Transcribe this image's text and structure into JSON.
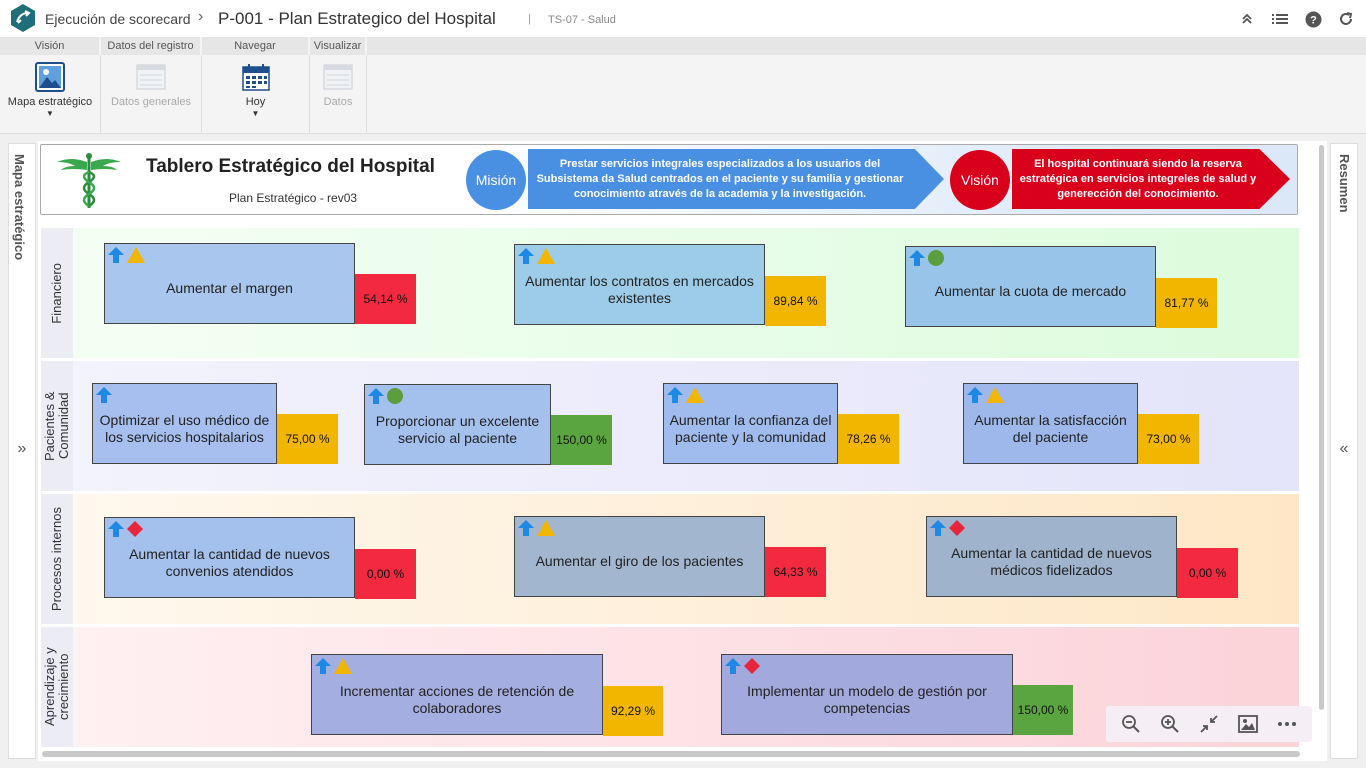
{
  "header": {
    "app_section": "Ejecución de scorecard",
    "page_title": "P-001 - Plan Estrategico del Hospital",
    "context": "TS-07 - Salud"
  },
  "ribbon": {
    "tabs": [
      "Visión",
      "Datos del registro",
      "Navegar",
      "Visualizar"
    ],
    "buttons": {
      "mapa": "Mapa estratégico",
      "datos_generales": "Datos generales",
      "hoy": "Hoy",
      "datos": "Datos"
    }
  },
  "panels": {
    "left_title": "Mapa estratégico",
    "right_title": "Resumen",
    "expand": "»",
    "collapse": "«"
  },
  "scorecard": {
    "title": "Tablero Estratégico del Hospital",
    "subtitle": "Plan Estratégico - rev03",
    "mision_label": "Misión",
    "mision_text": "Prestar servicios integrales especializados a los usuarios del Subsistema da Salud centrados en el paciente y su familia y gestionar conocimiento através de la academia y la investigación.",
    "vision_label": "Visión",
    "vision_text": "El hospital continuará siendo la reserva estratégica en servicios integreles de salud y generección del conocimiento."
  },
  "colors": {
    "blue": "#1e88e5",
    "yellow": "#f2b600",
    "green": "#5a9e3e",
    "red": "#e8253b",
    "pct_red": "#f2293f",
    "pct_yellow": "#f2b600",
    "pct_green": "#5aa53f"
  },
  "perspectives": [
    {
      "name": "Financiero",
      "objectives": [
        {
          "text": "Aumentar el margen",
          "pct": "54,14 %",
          "status": "red",
          "indicator": "triangle"
        },
        {
          "text": "Aumentar los contratos en mercados existentes",
          "pct": "89,84 %",
          "status": "yellow",
          "indicator": "triangle"
        },
        {
          "text": "Aumentar la cuota de mercado",
          "pct": "81,77 %",
          "status": "yellow",
          "indicator": "circle"
        }
      ]
    },
    {
      "name": "Pacientes & Comunidad",
      "objectives": [
        {
          "text": "Optimizar el uso médico de los servicios hospitalarios",
          "pct": "75,00 %",
          "status": "yellow",
          "indicator": "none"
        },
        {
          "text": "Proporcionar un excelente servicio al paciente",
          "pct": "150,00 %",
          "status": "green",
          "indicator": "circle"
        },
        {
          "text": "Aumentar la confianza del paciente y la comunidad",
          "pct": "78,26 %",
          "status": "yellow",
          "indicator": "triangle"
        },
        {
          "text": "Aumentar la satisfacción del paciente",
          "pct": "73,00 %",
          "status": "yellow",
          "indicator": "triangle"
        }
      ]
    },
    {
      "name": "Procesos internos",
      "objectives": [
        {
          "text": "Aumentar la cantidad de nuevos convenios atendidos",
          "pct": "0,00 %",
          "status": "red",
          "indicator": "diamond"
        },
        {
          "text": "Aumentar el giro de los pacientes",
          "pct": "64,33 %",
          "status": "red",
          "indicator": "triangle"
        },
        {
          "text": "Aumentar la cantidad de nuevos médicos fidelizados",
          "pct": "0,00 %",
          "status": "red",
          "indicator": "diamond"
        }
      ]
    },
    {
      "name": "Aprendizaje y crecimiento",
      "objectives": [
        {
          "text": "Incrementar acciones de retención de colaboradores",
          "pct": "92,29 %",
          "status": "yellow",
          "indicator": "triangle"
        },
        {
          "text": "Implementar un modelo de gestión por competencias",
          "pct": "150,00 %",
          "status": "green",
          "indicator": "diamond"
        }
      ]
    }
  ]
}
